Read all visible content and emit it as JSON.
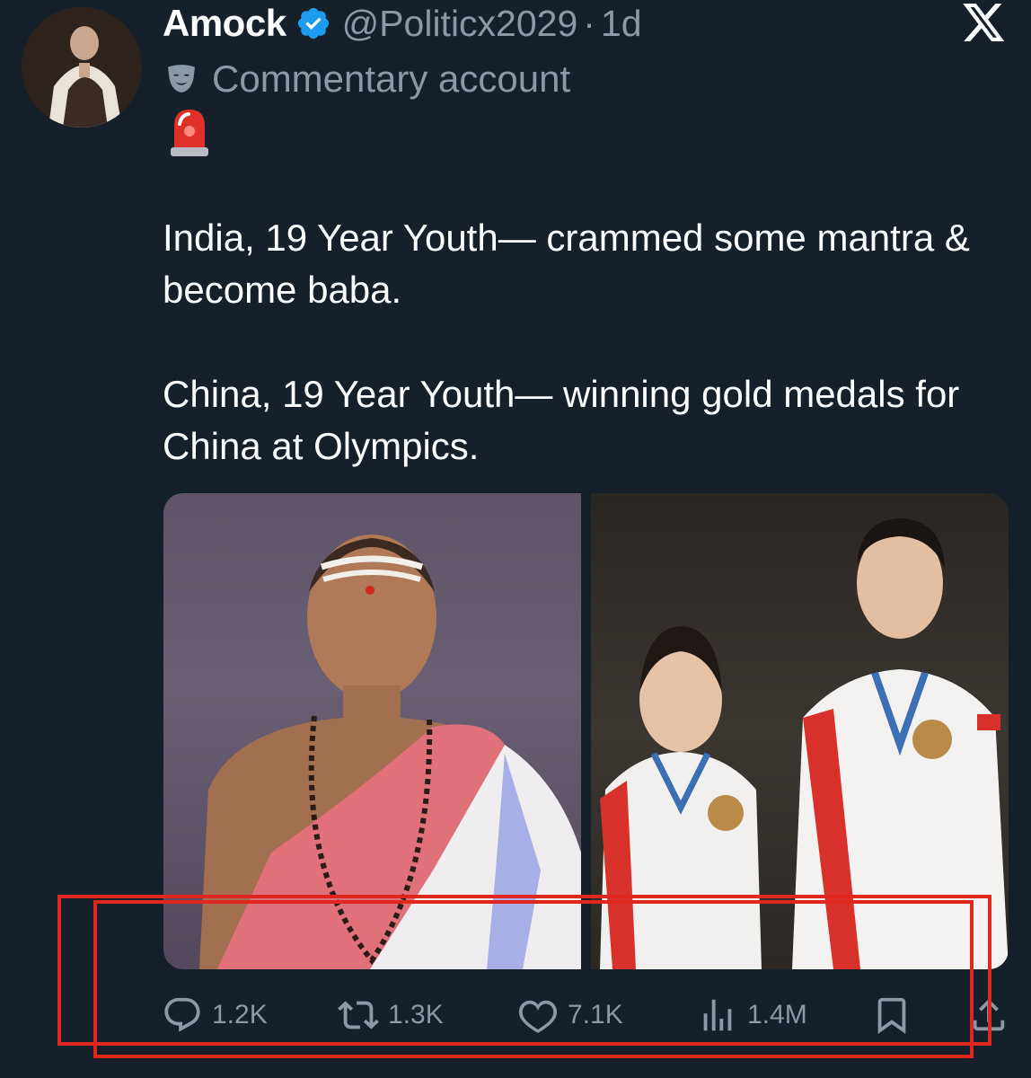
{
  "author": {
    "display_name": "Amock",
    "handle": "@Politicx2029",
    "separator": "·",
    "time": "1d",
    "label": "Commentary account"
  },
  "tweet": {
    "paragraphs": [
      "India, 19 Year Youth— crammed some mantra & become baba.",
      "China, 19 Year Youth— winning gold medals for China at Olympics."
    ]
  },
  "actions": {
    "replies": "1.2K",
    "reposts": "1.3K",
    "likes": "7.1K",
    "views": "1.4M"
  },
  "colors": {
    "background": "#15202b",
    "secondary_text": "#8b98a5",
    "verified": "#1d9bf0",
    "highlight": "#e0271f"
  },
  "icons": [
    "verified-badge-icon",
    "x-logo-icon",
    "mask-icon",
    "siren-icon",
    "reply-icon",
    "repost-icon",
    "like-icon",
    "views-icon",
    "bookmark-icon",
    "share-icon"
  ]
}
